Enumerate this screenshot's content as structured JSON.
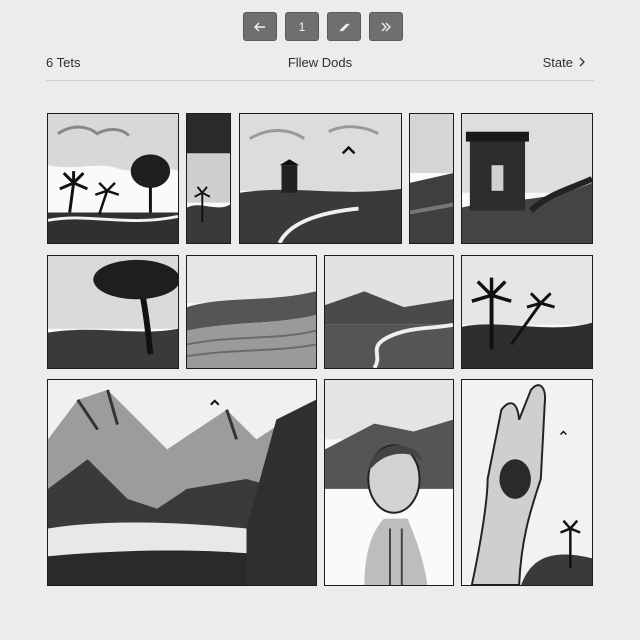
{
  "toolbar": {
    "buttons": [
      {
        "icon": "arrow-left-icon"
      },
      {
        "label": "1"
      },
      {
        "icon": "pen-icon"
      },
      {
        "icon": "double-chevron-right-icon"
      }
    ]
  },
  "header": {
    "left_label": "6 Tets",
    "center_label": "Fllew Dods",
    "right_label": "State",
    "right_icon": "chevron-right-icon"
  },
  "gallery": {
    "tiles": [
      {
        "subject": "palm trees on beach with deciduous tree"
      },
      {
        "subject": "narrow palm and tree strip"
      },
      {
        "subject": "tower on coastal landscape with bird and winding path"
      },
      {
        "subject": "narrow cliff"
      },
      {
        "subject": "ruined stone tower on hill"
      },
      {
        "subject": "large tree over plain"
      },
      {
        "subject": "rolling dunes"
      },
      {
        "subject": "river through hills"
      },
      {
        "subject": "palm trees on shore"
      },
      {
        "subject": "mountain lake landscape"
      },
      {
        "subject": "portrait of person looking up"
      },
      {
        "subject": "raised hand with screaming face, palm tree"
      }
    ]
  },
  "colors": {
    "background": "#ececec",
    "button": "#6f6f6f",
    "ink": "#1c1c1c"
  }
}
